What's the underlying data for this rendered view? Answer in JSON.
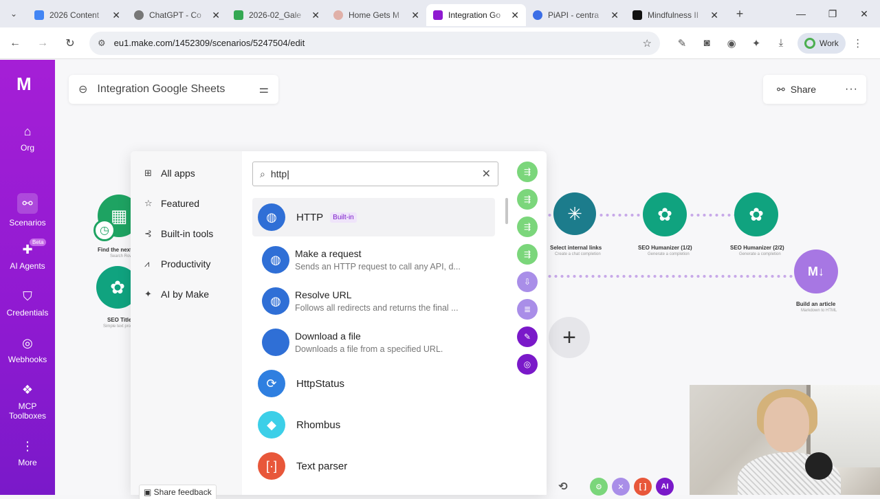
{
  "browser": {
    "tabs": [
      {
        "title": "2026 Content",
        "color": "#4285f4"
      },
      {
        "title": "ChatGPT - Co",
        "color": "#555555"
      },
      {
        "title": "2026-02_Gale",
        "color": "#34a853"
      },
      {
        "title": "Home Gets M",
        "color": "#e0b0a8"
      },
      {
        "title": "Integration Go",
        "color": "#8f1ad1"
      },
      {
        "title": "PiAPI - centra",
        "color": "#3b6ee6"
      },
      {
        "title": "Mindfulness II",
        "color": "#111111"
      }
    ],
    "url": "eu1.make.com/1452309/scenarios/5247504/edit",
    "profile_label": "Work"
  },
  "sidebar": {
    "logo": "M",
    "items": [
      {
        "label": "Org",
        "icon": "home-icon"
      },
      {
        "label": "Scenarios",
        "icon": "share-nodes-icon"
      },
      {
        "label": "AI Agents",
        "icon": "agent-icon",
        "badge": "Beta"
      },
      {
        "label": "Credentials",
        "icon": "shield-icon"
      },
      {
        "label": "Webhooks",
        "icon": "globe-icon"
      },
      {
        "label": "MCP Toolboxes",
        "icon": "toolbox-icon"
      },
      {
        "label": "More",
        "icon": "more-vertical-icon"
      }
    ]
  },
  "scenario": {
    "title": "Integration Google Sheets",
    "share_label": "Share"
  },
  "canvas_nodes": [
    {
      "label": "Find the next",
      "sub": "Search Rows"
    },
    {
      "label": "SEO Title",
      "sub": "Simple text prompt"
    },
    {
      "label": "Select internal links",
      "sub": "Create a chat completion"
    },
    {
      "label": "SEO Humanizer (1/2)",
      "sub": "Generate a completion"
    },
    {
      "label": "SEO Humanizer (2/2)",
      "sub": "Generate a completion"
    },
    {
      "label": "Build an article",
      "sub": "Markdown to HTML"
    }
  ],
  "picker": {
    "categories": [
      {
        "label": "All apps",
        "icon": "grid-icon"
      },
      {
        "label": "Featured",
        "icon": "star-icon"
      },
      {
        "label": "Built-in tools",
        "icon": "tools-icon"
      },
      {
        "label": "Productivity",
        "icon": "chart-icon"
      },
      {
        "label": "AI by Make",
        "icon": "sparkle-icon"
      }
    ],
    "search_value": "http",
    "feedback_label": "Share feedback",
    "http_app": {
      "name": "HTTP",
      "badge": "Built-in"
    },
    "modules": [
      {
        "name": "Make a request",
        "desc": "Sends an HTTP request to call any API, d..."
      },
      {
        "name": "Resolve URL",
        "desc": "Follows all redirects and returns the final ..."
      },
      {
        "name": "Download a file",
        "desc": "Downloads a file from a specified URL."
      }
    ],
    "other_apps": [
      {
        "name": "HttpStatus",
        "color": "#2f7fe0"
      },
      {
        "name": "Rhombus",
        "color": "#3ccfe8"
      },
      {
        "name": "Text parser",
        "color": "#e8573a"
      }
    ]
  },
  "colors": {
    "brand": "#8f1ad1",
    "http_blue": "#2f6fd6",
    "openai_green": "#10a37f"
  }
}
